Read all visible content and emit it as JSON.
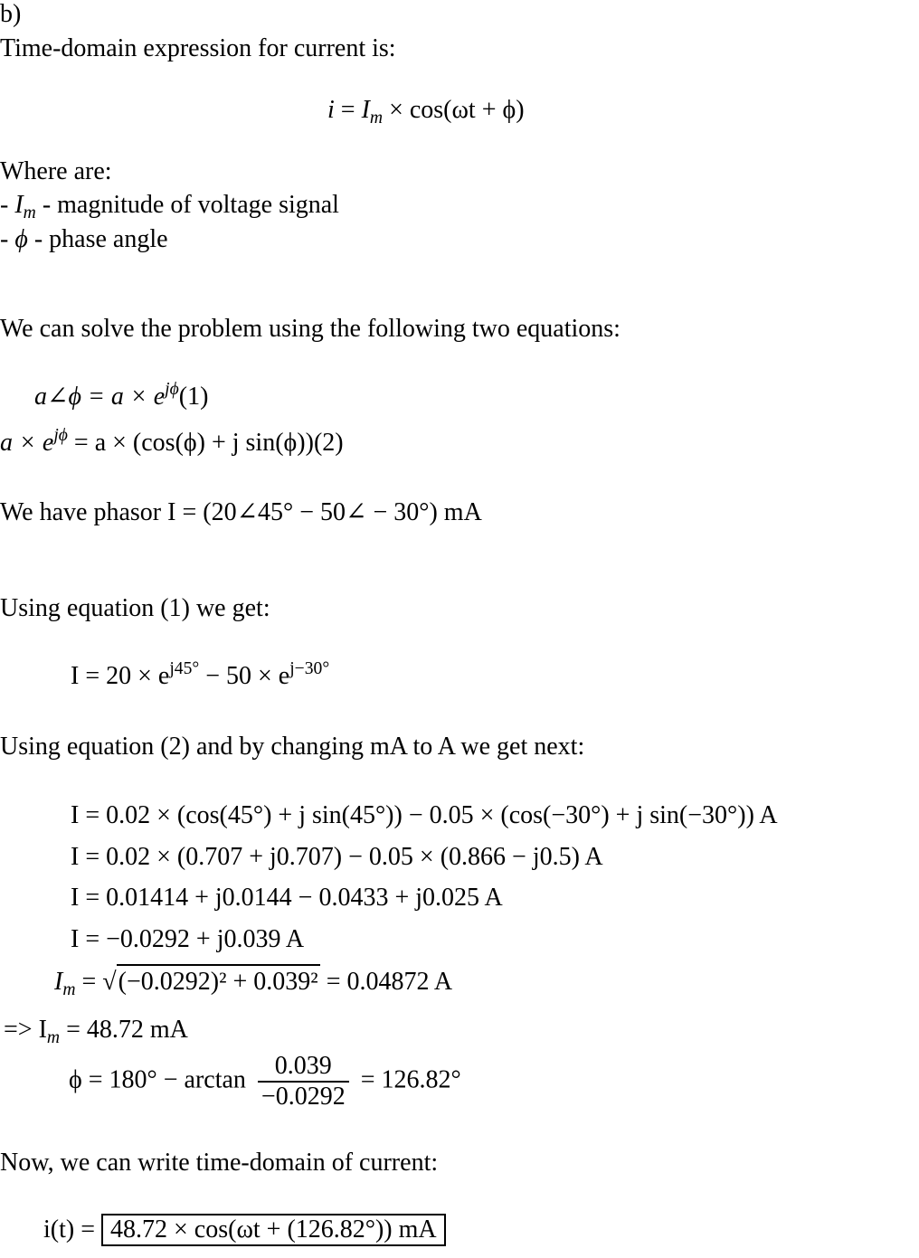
{
  "part_label": "b)",
  "intro": "Time-domain expression for current is:",
  "main_formula": {
    "lhs": "i",
    "rhs_pre": "I",
    "rhs_sub": "m",
    "rhs_post": " × cos(ωt + ϕ)"
  },
  "where_heading": "Where are:",
  "definitions": [
    {
      "prefix": "- ",
      "symbol": "I",
      "sub": "m",
      "text": " - magnitude of voltage signal"
    },
    {
      "prefix": "- ",
      "symbol": "ϕ",
      "sub": "",
      "text": " - phase angle"
    }
  ],
  "solve_text": "We can solve the problem using the following two equations:",
  "eq1": {
    "lhs": "a∠ϕ = a × e",
    "sup": "jϕ",
    "tag": "(1)"
  },
  "eq2": {
    "lhs": "a × e",
    "sup": "jϕ",
    "rhs": " = a × (cos(ϕ) + j sin(ϕ))",
    "tag": "(2)"
  },
  "phasor_text": "We have phasor ",
  "phasor_expr": "I = (20∠45° − 50∠ − 30°) mA",
  "using_eq1": "Using equation (1) we get:",
  "eq_exp": {
    "part1": "I = 20 × e",
    "sup1": "j45°",
    "part2": " − 50 × e",
    "sup2": "j−30°"
  },
  "using_eq2": "Using equation (2) and by changing mA to A we get next:",
  "steps": [
    "I = 0.02 × (cos(45°) + j sin(45°)) − 0.05 × (cos(−30°) + j sin(−30°)) A",
    "I = 0.02 × (0.707 + j0.707) − 0.05 × (0.866 − j0.5) A",
    "I = 0.01414 + j0.0144 − 0.0433 + j0.025 A",
    "I = −0.0292 + j0.039 A"
  ],
  "magnitude": {
    "lhs": "I",
    "sub": "m",
    "radicand": "(−0.0292)² + 0.039²",
    "result": " = 0.04872 A"
  },
  "magnitude_ma": {
    "prefix": "=> I",
    "sub": "m",
    "rest": " = 48.72 mA"
  },
  "phase": {
    "lhs": "ϕ = 180° − arctan",
    "numerator": "0.039",
    "denominator": "−0.0292",
    "result": "= 126.82°"
  },
  "conclusion_text": "Now, we can write time-domain of current:",
  "final": {
    "lhs": "i(t) = ",
    "boxed": "48.72 × cos(ωt + (126.82°)) mA"
  }
}
